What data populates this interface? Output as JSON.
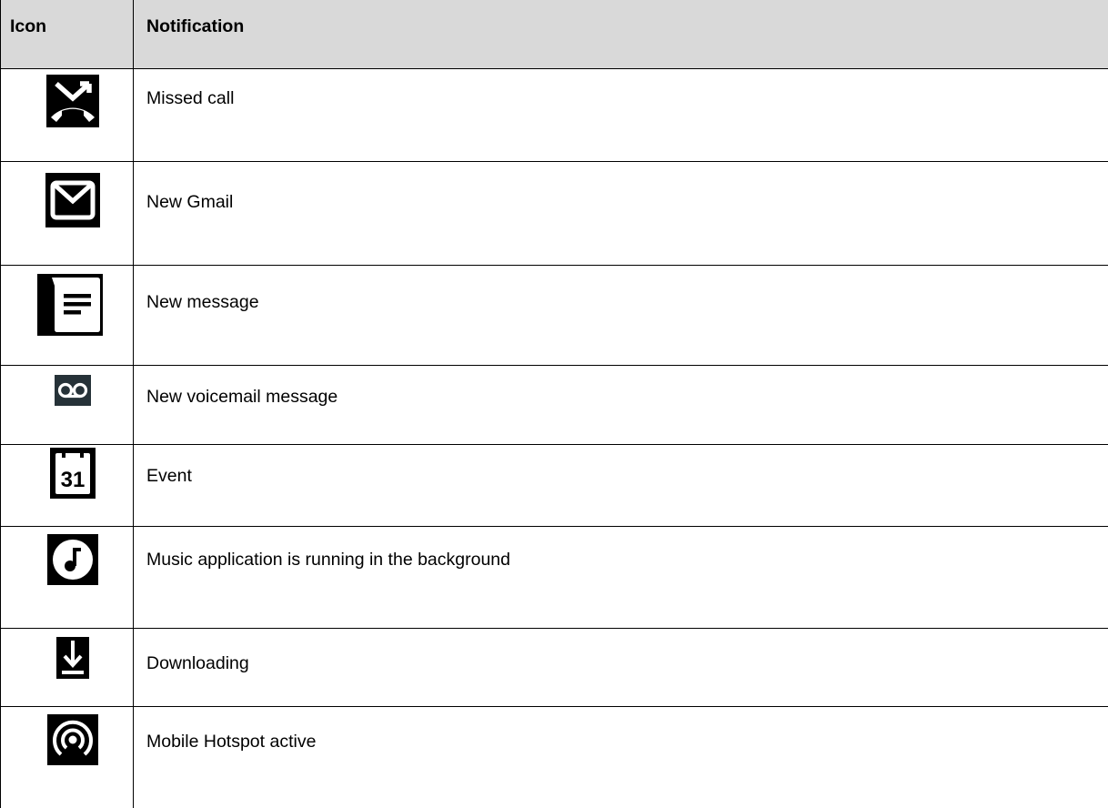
{
  "table": {
    "headers": {
      "icon": "Icon",
      "notification": "Notification"
    },
    "rows": [
      {
        "icon": "missed-call-icon",
        "label": "Missed call"
      },
      {
        "icon": "gmail-icon",
        "label": "New Gmail"
      },
      {
        "icon": "message-icon",
        "label": "New message"
      },
      {
        "icon": "voicemail-icon",
        "label": "New voicemail message"
      },
      {
        "icon": "calendar-event-icon",
        "label": "Event"
      },
      {
        "icon": "music-icon",
        "label": "Music application is running in the background"
      },
      {
        "icon": "download-icon",
        "label": "Downloading"
      },
      {
        "icon": "hotspot-icon",
        "label": "Mobile Hotspot active"
      }
    ],
    "calendar_day": "31"
  },
  "colors": {
    "header_bg": "#d9d9d9",
    "icon_bg": "#000000",
    "voicemail_icon_bg": "#263238",
    "border": "#000000"
  }
}
